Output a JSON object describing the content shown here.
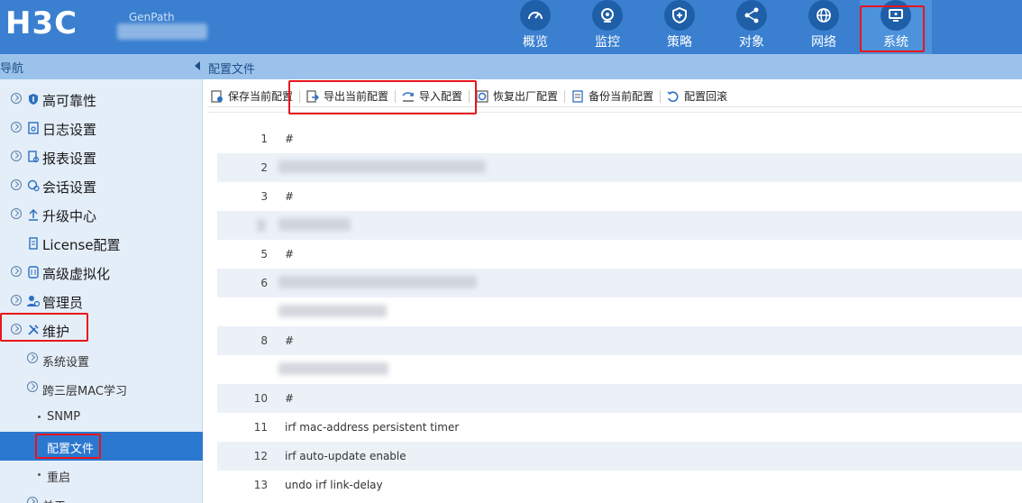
{
  "header": {
    "logo": "H3C",
    "device_name": "GenPath",
    "nav": [
      {
        "label": "概览",
        "icon": "gauge-icon"
      },
      {
        "label": "监控",
        "icon": "monitor-eye-icon"
      },
      {
        "label": "策略",
        "icon": "shield-plus-icon"
      },
      {
        "label": "对象",
        "icon": "share-nodes-icon"
      },
      {
        "label": "网络",
        "icon": "globe-icon"
      },
      {
        "label": "系统",
        "icon": "computer-icon",
        "active": true
      }
    ]
  },
  "subbar": {
    "nav_title": "导航",
    "page_title": "配置文件"
  },
  "sidebar": {
    "items": [
      {
        "label": "高可靠性",
        "icon": "shield-icon"
      },
      {
        "label": "日志设置",
        "icon": "log-icon"
      },
      {
        "label": "报表设置",
        "icon": "report-icon"
      },
      {
        "label": "会话设置",
        "icon": "session-icon"
      },
      {
        "label": "升级中心",
        "icon": "upload-icon"
      },
      {
        "label": "License配置",
        "icon": "license-icon"
      },
      {
        "label": "高级虚拟化",
        "icon": "virtual-icon"
      },
      {
        "label": "管理员",
        "icon": "admin-icon"
      },
      {
        "label": "维护",
        "icon": "wrench-icon"
      }
    ],
    "subitems": [
      {
        "label": "系统设置"
      },
      {
        "label": "跨三层MAC学习"
      }
    ],
    "leaves": [
      {
        "label": "SNMP"
      },
      {
        "label": "配置文件",
        "selected": true
      },
      {
        "label": "重启"
      },
      {
        "label": "关于"
      }
    ]
  },
  "toolbar": {
    "buttons": [
      {
        "label": "保存当前配置",
        "icon": "save-config-icon"
      },
      {
        "label": "导出当前配置",
        "icon": "export-icon"
      },
      {
        "label": "导入配置",
        "icon": "import-icon"
      },
      {
        "label": "恢复出厂配置",
        "icon": "restore-icon"
      },
      {
        "label": "备份当前配置",
        "icon": "backup-icon"
      },
      {
        "label": "配置回滚",
        "icon": "rollback-icon"
      }
    ]
  },
  "config_lines": [
    {
      "n": "1",
      "text": "#"
    },
    {
      "n": "2",
      "text": ""
    },
    {
      "n": "3",
      "text": "#"
    },
    {
      "n": "",
      "text": ""
    },
    {
      "n": "5",
      "text": "#"
    },
    {
      "n": "6",
      "text": ""
    },
    {
      "n": "",
      "text": ""
    },
    {
      "n": "8",
      "text": "#"
    },
    {
      "n": "",
      "text": ""
    },
    {
      "n": "10",
      "text": "#"
    },
    {
      "n": "11",
      "text": "irf mac-address persistent timer"
    },
    {
      "n": "12",
      "text": "irf auto-update enable"
    },
    {
      "n": "13",
      "text": "undo irf link-delay"
    }
  ],
  "colors": {
    "header": "#3a7fd0",
    "subbar": "#9bc2ea",
    "sidebar": "#e4eef9",
    "selected": "#2b78d0",
    "highlight": "#e8151b"
  }
}
